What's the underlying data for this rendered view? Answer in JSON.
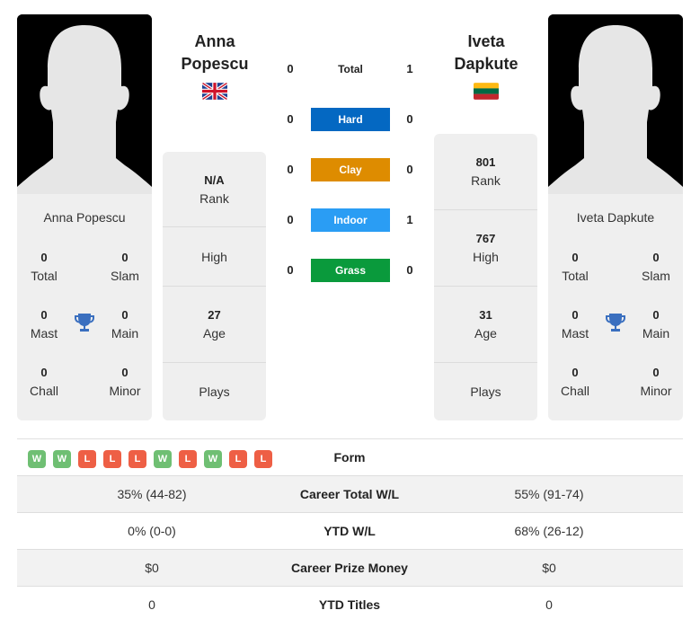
{
  "player_left": {
    "name": "Anna Popescu",
    "name_line1": "Anna",
    "name_line2": "Popescu",
    "flag": "united-kingdom",
    "titles": {
      "total": {
        "value": "0",
        "label": "Total"
      },
      "slam": {
        "value": "0",
        "label": "Slam"
      },
      "mast": {
        "value": "0",
        "label": "Mast"
      },
      "main": {
        "value": "0",
        "label": "Main"
      },
      "chall": {
        "value": "0",
        "label": "Chall"
      },
      "minor": {
        "value": "0",
        "label": "Minor"
      }
    },
    "rank": {
      "value": "N/A",
      "label": "Rank"
    },
    "high": {
      "value": "",
      "label": "High"
    },
    "age": {
      "value": "27",
      "label": "Age"
    },
    "plays": {
      "value": "",
      "label": "Plays"
    }
  },
  "player_right": {
    "name": "Iveta Dapkute",
    "name_line1": "Iveta",
    "name_line2": "Dapkute",
    "flag": "lithuania",
    "titles": {
      "total": {
        "value": "0",
        "label": "Total"
      },
      "slam": {
        "value": "0",
        "label": "Slam"
      },
      "mast": {
        "value": "0",
        "label": "Mast"
      },
      "main": {
        "value": "0",
        "label": "Main"
      },
      "chall": {
        "value": "0",
        "label": "Chall"
      },
      "minor": {
        "value": "0",
        "label": "Minor"
      }
    },
    "rank": {
      "value": "801",
      "label": "Rank"
    },
    "high": {
      "value": "767",
      "label": "High"
    },
    "age": {
      "value": "31",
      "label": "Age"
    },
    "plays": {
      "value": "",
      "label": "Plays"
    }
  },
  "h2h": [
    {
      "label": "Total",
      "left": "0",
      "right": "1",
      "color": ""
    },
    {
      "label": "Hard",
      "left": "0",
      "right": "0",
      "color": "#0468c2"
    },
    {
      "label": "Clay",
      "left": "0",
      "right": "0",
      "color": "#de8c00"
    },
    {
      "label": "Indoor",
      "left": "0",
      "right": "1",
      "color": "#2a9df4"
    },
    {
      "label": "Grass",
      "left": "0",
      "right": "0",
      "color": "#0a9a3c"
    }
  ],
  "form": {
    "label": "Form",
    "left": [
      "W",
      "W",
      "L",
      "L",
      "L",
      "W",
      "L",
      "W",
      "L",
      "L"
    ]
  },
  "stats": [
    {
      "label": "Career Total W/L",
      "left": "35% (44-82)",
      "right": "55% (91-74)"
    },
    {
      "label": "YTD W/L",
      "left": "0% (0-0)",
      "right": "68% (26-12)"
    },
    {
      "label": "Career Prize Money",
      "left": "$0",
      "right": "$0"
    },
    {
      "label": "YTD Titles",
      "left": "0",
      "right": "0"
    }
  ],
  "colors": {
    "win": "#6fbf73",
    "loss": "#ee5f45",
    "trophy": "#3a6fbf"
  }
}
